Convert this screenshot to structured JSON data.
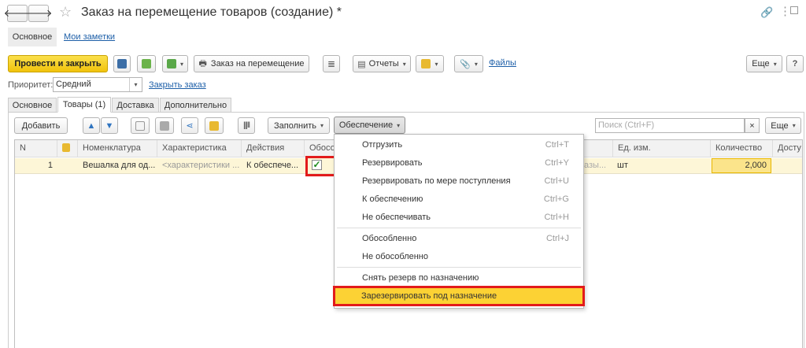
{
  "window": {
    "title": "Заказ на перемещение товаров (создание) *"
  },
  "form_tabs": [
    {
      "label": "Основное"
    },
    {
      "label": "Мои заметки"
    }
  ],
  "toolbar": {
    "post_close": "Провести и закрыть",
    "transfer_order": "Заказ на перемещение",
    "reports": "Отчеты",
    "files": "Файлы",
    "more": "Еще"
  },
  "priority": {
    "label": "Приоритет:",
    "value": "Средний",
    "close_order": "Закрыть заказ"
  },
  "sub_tabs": [
    {
      "label": "Основное"
    },
    {
      "label": "Товары (1)"
    },
    {
      "label": "Доставка"
    },
    {
      "label": "Дополнительно"
    }
  ],
  "goods_toolbar": {
    "add": "Добавить",
    "fill": "Заполнить",
    "provision": "Обеспечение",
    "search_placeholder": "Поиск (Ctrl+F)",
    "clear": "×",
    "more": "Еще"
  },
  "table": {
    "columns": [
      "N",
      "",
      "Номенклатура",
      "Характеристика",
      "Действия",
      "Обосо",
      "Ед. изм.",
      "Количество",
      "Досту"
    ],
    "rows": [
      {
        "n": "1",
        "item": "Вешалка для од...",
        "characteristic": "<характеристики ...",
        "action": "К обеспече...",
        "separate": "✓",
        "hidden_tail": "азы...",
        "unit": "шт",
        "quantity": "2,000"
      }
    ]
  },
  "provision_menu": [
    {
      "label": "Отгрузить",
      "shortcut": "Ctrl+T"
    },
    {
      "label": "Резервировать",
      "shortcut": "Ctrl+Y"
    },
    {
      "label": "Резервировать по мере поступления",
      "shortcut": "Ctrl+U"
    },
    {
      "label": "К обеспечению",
      "shortcut": "Ctrl+G"
    },
    {
      "label": "Не обеспечивать",
      "shortcut": "Ctrl+H"
    },
    {
      "label": "Обособленно",
      "shortcut": "Ctrl+J"
    },
    {
      "label": "Не обособленно",
      "shortcut": ""
    },
    {
      "label": "Снять резерв по назначению",
      "shortcut": ""
    },
    {
      "label": "Зарезервировать под назначение",
      "shortcut": ""
    }
  ],
  "colors": {
    "accent_yellow": "#f7d31e",
    "highlight": "#e21b1b",
    "row_selected": "#fdf6d7",
    "menu_hover": "#fcd234"
  }
}
